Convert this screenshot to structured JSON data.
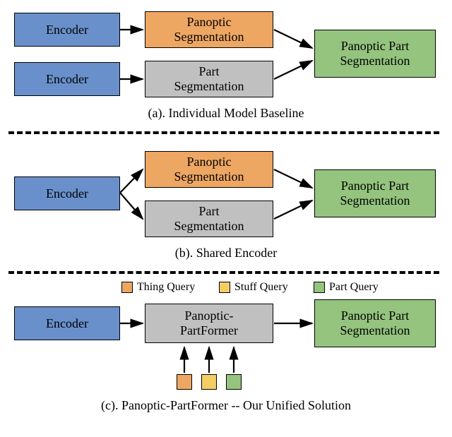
{
  "a": {
    "encoder1": "Encoder",
    "encoder2": "Encoder",
    "panoptic": "Panoptic\nSegmentation",
    "part": "Part\nSegmentation",
    "output": "Panoptic Part Segmentation",
    "caption": "(a). Individual Model Baseline"
  },
  "b": {
    "encoder": "Encoder",
    "panoptic": "Panoptic\nSegmentation",
    "part": "Part\nSegmentation",
    "output": "Panoptic Part Segmentation",
    "caption": "(b). Shared Encoder"
  },
  "c": {
    "legend_thing": "Thing Query",
    "legend_stuff": "Stuff Query",
    "legend_part": "Part Query",
    "encoder": "Encoder",
    "pp_box": "Panoptic-\nPartFormer",
    "output": "Panoptic Part Segmentation",
    "caption": "(c). Panoptic-PartFormer -- Our Unified Solution"
  }
}
